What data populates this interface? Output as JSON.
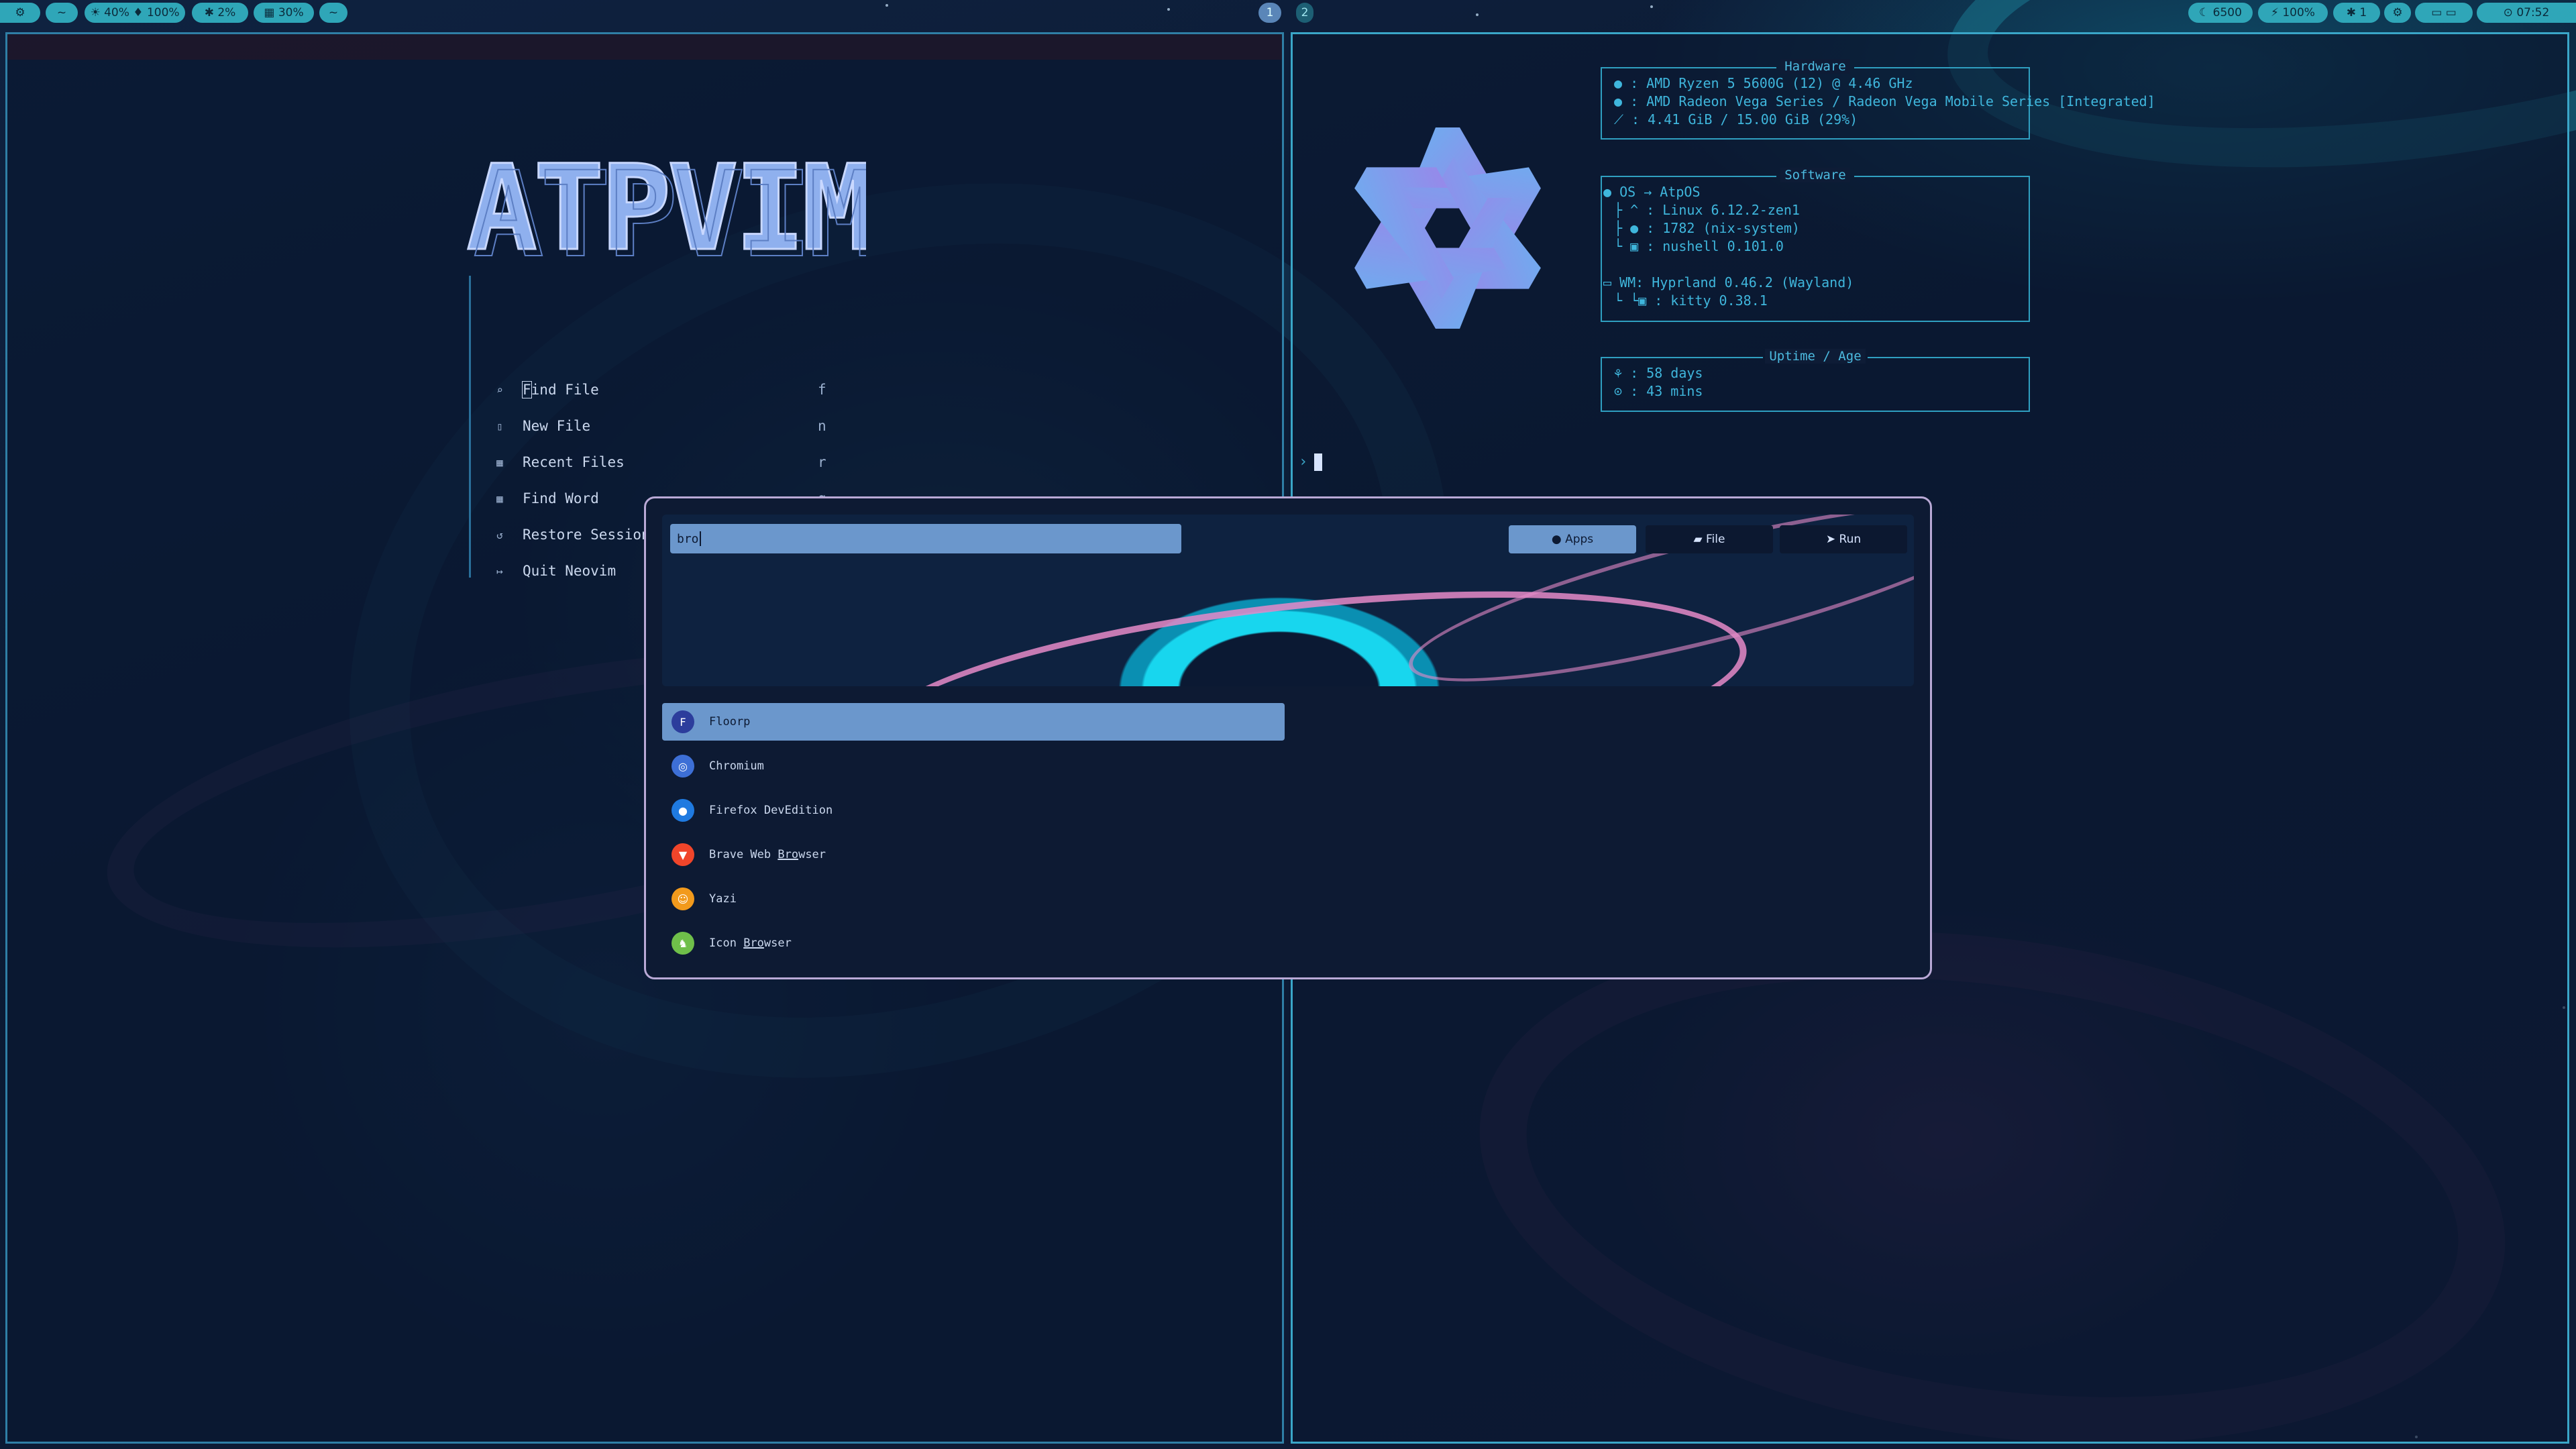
{
  "topbar": {
    "left": {
      "launcher": "⚙",
      "menu": "~",
      "volume_brightness": "☀ 40% ♦ 100%",
      "cpu": "✱ 2%",
      "ram": "▦ 30%",
      "extra": "~"
    },
    "workspaces": [
      "1",
      "2"
    ],
    "right": {
      "cursor_temp": "☾ 6500",
      "battery": "⚡ 100%",
      "notifications": "✱ 1",
      "settings": "⚙",
      "tray": "▭ ▭",
      "clock": "⊙ 07:52"
    }
  },
  "nvim": {
    "logo_text": "ATPVIM",
    "menu": [
      {
        "icon": "search-icon",
        "glyph": "⌕",
        "label_first": "F",
        "label_rest": "ind File",
        "key": "f"
      },
      {
        "icon": "file-icon",
        "glyph": "▯",
        "label_first": "N",
        "label_rest": "ew File",
        "key": "n"
      },
      {
        "icon": "recent-icon",
        "glyph": "▦",
        "label_first": "R",
        "label_rest": "ecent Files",
        "key": "r"
      },
      {
        "icon": "word-icon",
        "glyph": "▦",
        "label_first": "F",
        "label_rest": "ind Word",
        "key": "g"
      },
      {
        "icon": "restore-icon",
        "glyph": "↺",
        "label_first": "R",
        "label_rest": "estore Session",
        "key": ""
      },
      {
        "icon": "quit-icon",
        "glyph": "↦",
        "label_first": "Q",
        "label_rest": "uit Neovim",
        "key": ""
      }
    ]
  },
  "fastfetch": {
    "hardware_title": "Hardware",
    "hardware": [
      "● : AMD Ryzen 5 5600G (12) @ 4.46 GHz",
      "● : AMD Radeon Vega Series / Radeon Vega Mobile Series [Integrated]",
      "⟋ : 4.41 GiB / 15.00 GiB (29%)"
    ],
    "software_title": "Software",
    "software": [
      "● OS → AtpOS",
      "├ ^ : Linux 6.12.2-zen1",
      "├ ● : 1782 (nix-system)",
      "└ ▣ : nushell 0.101.0",
      "▭ WM: Hyprland 0.46.2 (Wayland)",
      "└ └▣ : kitty 0.38.1"
    ],
    "uptime_title": "Uptime / Age",
    "uptime": [
      "⚘ : 58 days",
      "⊙ : 43 mins"
    ],
    "prompt": "›"
  },
  "launcher": {
    "query": "bro",
    "tabs": [
      {
        "label": "● Apps",
        "active": true
      },
      {
        "label": "▰ File",
        "active": false
      },
      {
        "label": "➤ Run",
        "active": false
      }
    ],
    "results": [
      {
        "name": "Floorp",
        "icon": "floorp-icon",
        "color": "#2c3d9c",
        "selected": true
      },
      {
        "name": "Chromium",
        "icon": "chromium-icon",
        "color": "#3d6fd6",
        "selected": false
      },
      {
        "name": "Firefox DevEdition",
        "icon": "firefox-icon",
        "color": "#1f7ae0",
        "selected": false
      },
      {
        "name_pre": "Brave Web ",
        "name_u": "Bro",
        "name_post": "wser",
        "icon": "brave-icon",
        "color": "#f0452a",
        "selected": false
      },
      {
        "name": "Yazi",
        "icon": "yazi-icon",
        "color": "#f29a1c",
        "selected": false
      },
      {
        "name_pre": "Icon ",
        "name_u": "Bro",
        "name_post": "wser",
        "icon": "icon-browser-icon",
        "color": "#6fbf4a",
        "selected": false
      }
    ]
  },
  "colors": {
    "accent": "#2fa6b8",
    "selection": "#6b97cc",
    "launcher_border": "#b9a9d6",
    "logo": "#8fb0ee"
  }
}
